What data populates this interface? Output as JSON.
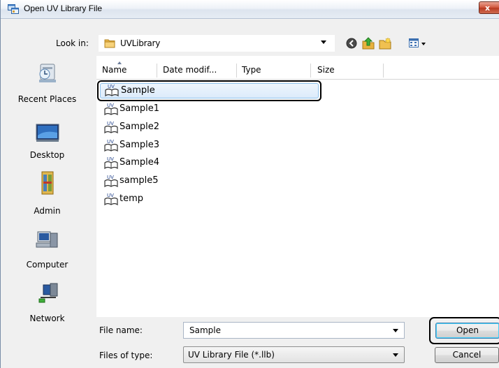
{
  "window": {
    "title": "Open UV Library File",
    "close_label": "x"
  },
  "lookin": {
    "label": "Look in:",
    "value": "UVLibrary"
  },
  "toolbar": {
    "icons": [
      "back-icon",
      "up-folder-icon",
      "new-folder-icon",
      "views-menu-icon"
    ]
  },
  "places": [
    {
      "label": "Recent Places",
      "icon": "recent-places-icon"
    },
    {
      "label": "Desktop",
      "icon": "desktop-icon"
    },
    {
      "label": "Admin",
      "icon": "user-folder-icon"
    },
    {
      "label": "Computer",
      "icon": "computer-icon"
    },
    {
      "label": "Network",
      "icon": "network-icon"
    }
  ],
  "columns": [
    "Name",
    "Date modif...",
    "Type",
    "Size"
  ],
  "files": [
    {
      "name": "Sample",
      "selected": true
    },
    {
      "name": "Sample1"
    },
    {
      "name": "Sample2"
    },
    {
      "name": "Sample3"
    },
    {
      "name": "Sample4"
    },
    {
      "name": "sample5"
    },
    {
      "name": "temp"
    }
  ],
  "filename": {
    "label": "File name:",
    "value": "Sample"
  },
  "filetype": {
    "label": "Files of type:",
    "value": "UV Library File (*.llb)"
  },
  "buttons": {
    "open": "Open",
    "cancel": "Cancel"
  },
  "colors": {
    "selection": "#dcebfb",
    "selection_border": "#8fc2ec",
    "close_button": "#c8452d"
  }
}
